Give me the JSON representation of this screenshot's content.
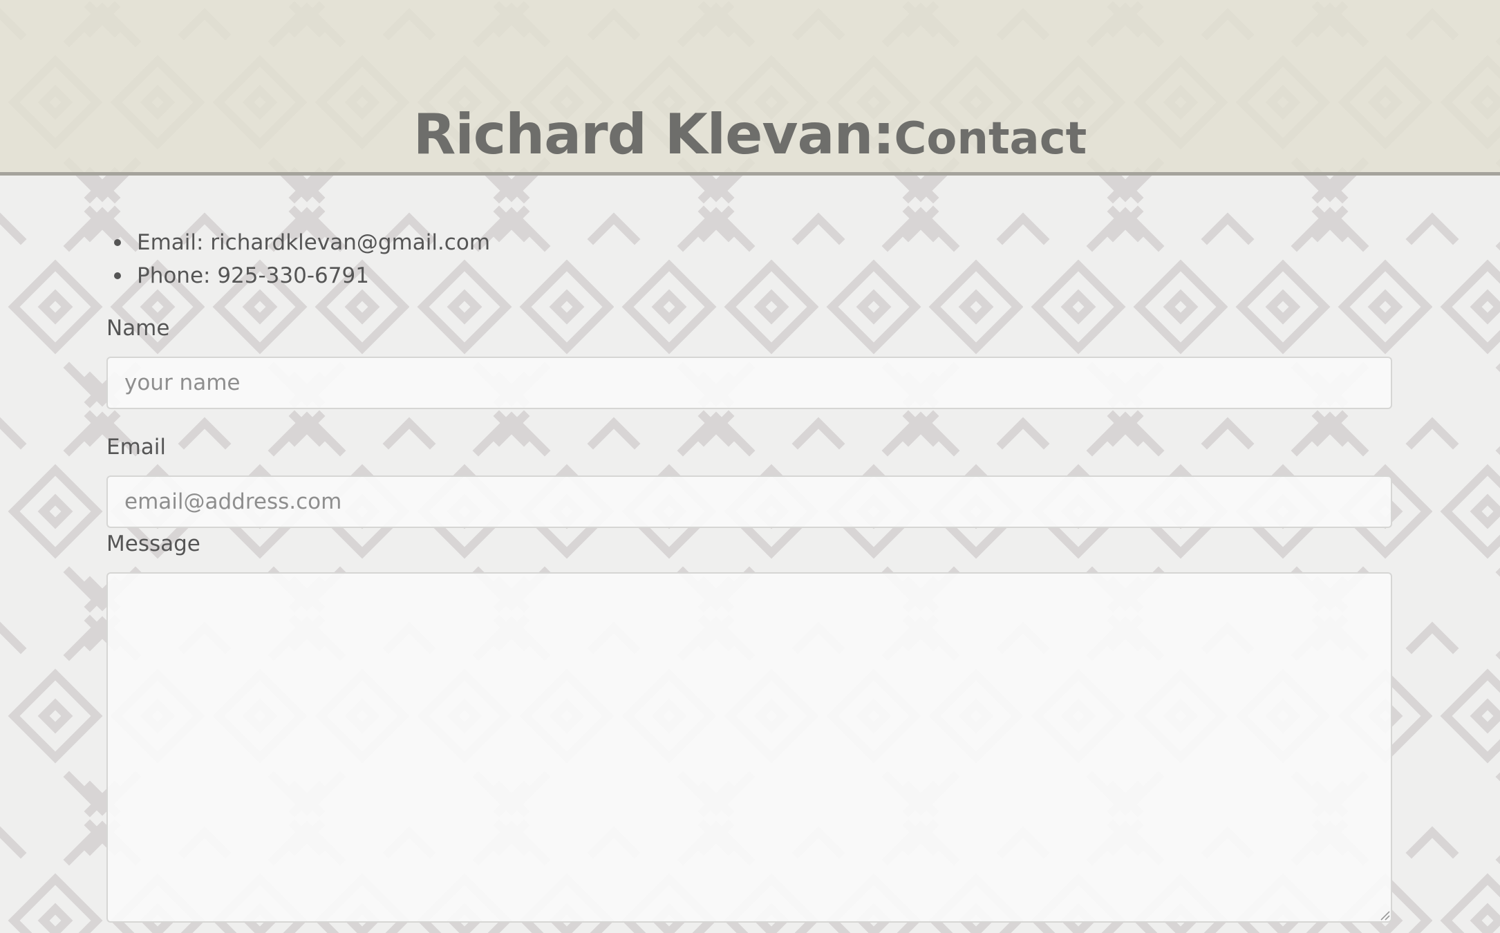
{
  "header": {
    "name": "Richard Klevan:",
    "section": "Contact"
  },
  "contact": {
    "items": [
      {
        "text": "Email: richardklevan@gmail.com"
      },
      {
        "text": "Phone: 925-330-6791"
      }
    ]
  },
  "form": {
    "name_label": "Name",
    "name_placeholder": "your name",
    "name_value": "",
    "email_label": "Email",
    "email_placeholder": "email@address.com",
    "email_value": "",
    "message_label": "Message",
    "message_value": ""
  },
  "colors": {
    "header_background": "#e2dfd1",
    "header_border": "#a5a39c",
    "page_background": "#efefee",
    "title_text": "#6e6e6b",
    "body_text": "#555555",
    "placeholder_text": "#8e8e8e",
    "pattern": "#d8d5d5"
  }
}
